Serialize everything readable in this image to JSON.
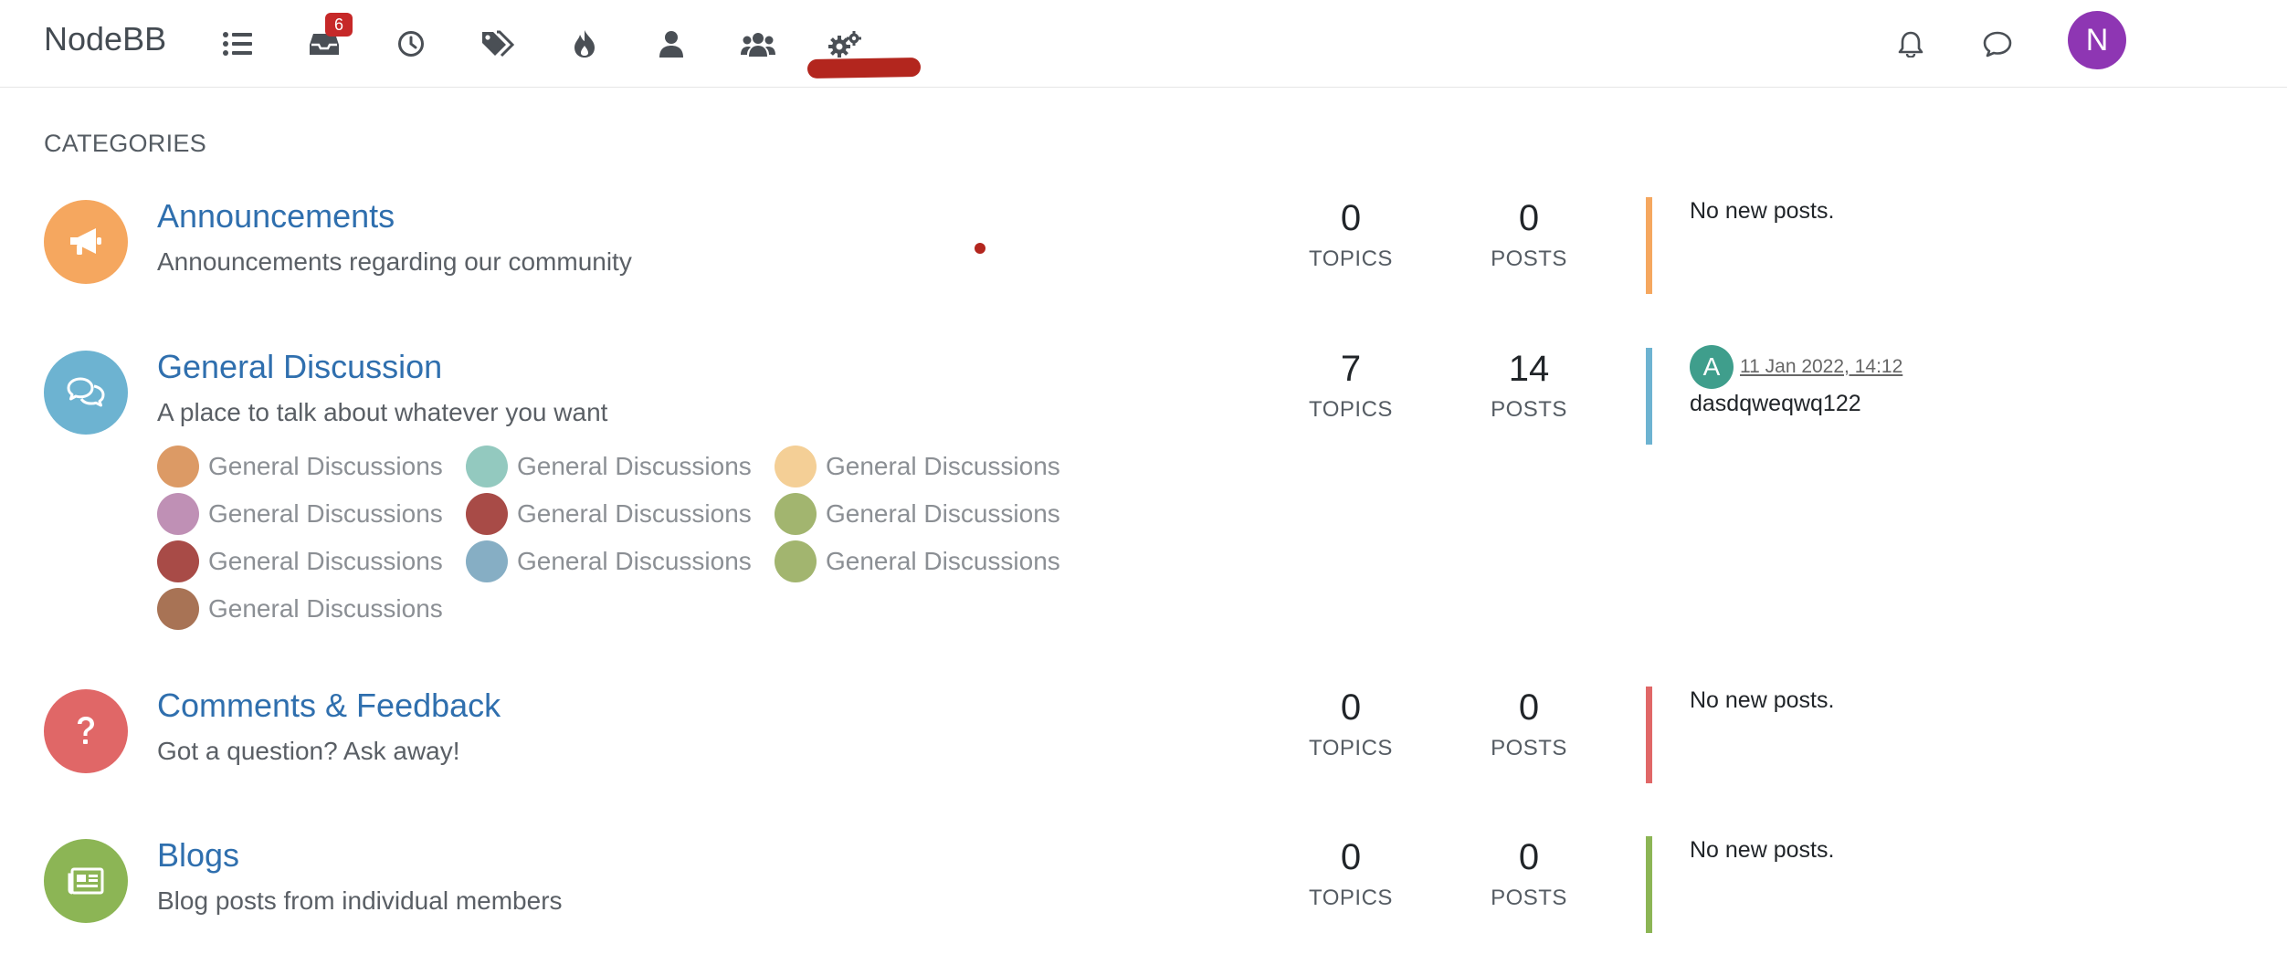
{
  "header": {
    "brand": "NodeBB",
    "unread_badge": "6",
    "user_initial": "N",
    "nav_icons": [
      "categories-icon",
      "unread-icon",
      "recent-icon",
      "tags-icon",
      "popular-icon",
      "users-icon",
      "groups-icon",
      "admin-icon",
      "notifications-icon",
      "chats-icon"
    ]
  },
  "section_title": "CATEGORIES",
  "categories": [
    {
      "title": "Announcements",
      "description": "Announcements regarding our community",
      "topics": "0",
      "topics_label": "TOPICS",
      "posts": "0",
      "posts_label": "POSTS",
      "teaser": "No new posts.",
      "color": "#f5a75f",
      "icon": "bullhorn-icon"
    },
    {
      "title": "General Discussion",
      "description": "A place to talk about whatever you want",
      "topics": "7",
      "topics_label": "TOPICS",
      "posts": "14",
      "posts_label": "POSTS",
      "teaser_avatar": "A",
      "teaser_date": "11 Jan 2022, 14:12",
      "teaser_user": "dasdqweqwq122",
      "color": "#6db3d1",
      "icon": "comments-icon",
      "subcategories": [
        {
          "label": "General Discussions",
          "color": "#dc9a65"
        },
        {
          "label": "General Discussions",
          "color": "#93c9bf"
        },
        {
          "label": "General Discussions",
          "color": "#f4cf96"
        },
        {
          "label": "General Discussions",
          "color": "#bf90b5"
        },
        {
          "label": "General Discussions",
          "color": "#a84b47"
        },
        {
          "label": "General Discussions",
          "color": "#a2b56f"
        },
        {
          "label": "General Discussions",
          "color": "#a84b47"
        },
        {
          "label": "General Discussions",
          "color": "#86aec4"
        },
        {
          "label": "General Discussions",
          "color": "#a2b56f"
        },
        {
          "label": "General Discussions",
          "color": "#a87355"
        }
      ]
    },
    {
      "title": "Comments & Feedback",
      "description": "Got a question? Ask away!",
      "topics": "0",
      "topics_label": "TOPICS",
      "posts": "0",
      "posts_label": "POSTS",
      "teaser": "No new posts.",
      "color": "#e06767",
      "icon": "question-icon"
    },
    {
      "title": "Blogs",
      "description": "Blog posts from individual members",
      "topics": "0",
      "topics_label": "TOPICS",
      "posts": "0",
      "posts_label": "POSTS",
      "teaser": "No new posts.",
      "color": "#8cb555",
      "icon": "newspaper-icon"
    }
  ]
}
